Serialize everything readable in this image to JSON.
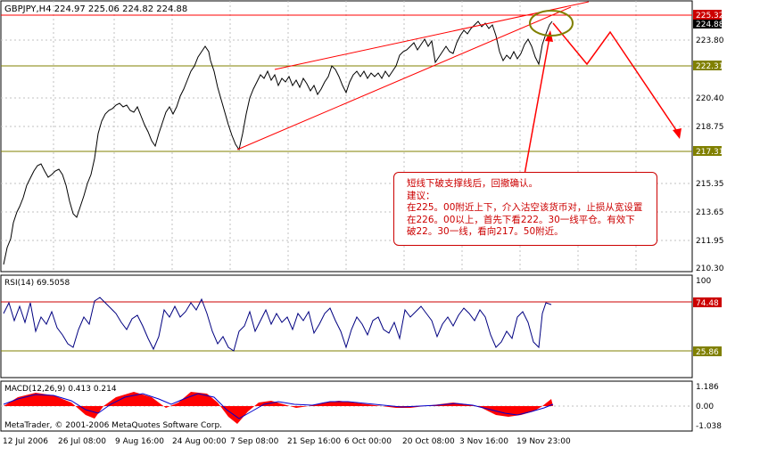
{
  "symbol_header": "GBPJPY,H4  224.97 225.06 224.82 224.88",
  "main_chart": {
    "price_ticks": [
      "223.80",
      "222.31",
      "220.40",
      "218.75",
      "217.31",
      "215.35",
      "213.65",
      "211.95",
      "210.30"
    ],
    "level_labels": {
      "resistance": "225.32",
      "current": "224.88",
      "support_upper": "222.31",
      "support_lower": "217.31"
    },
    "colors": {
      "price_line": "#000000",
      "channel": "#ff0000",
      "level": "#808000",
      "label_red_bg": "#cc0000",
      "label_olive_bg": "#808000",
      "grid": "#c0c0c0"
    }
  },
  "annotation": {
    "line1": "短线下破支撑线后，回撤确认。",
    "line2": "建议：",
    "line3": "在225。00附近上下，介入沽空该货币对，止损从宽设置",
    "line4": "在226。00以上，首先下看222。30一线平仓。有效下",
    "line5": "破22。30一线，看向217。50附近。"
  },
  "rsi_panel": {
    "title": "RSI(14) 69.5058",
    "upper_level": "74.48",
    "lower_level": "25.86",
    "top_tick": "100"
  },
  "macd_panel": {
    "title": "MACD(12,26,9) 0.413 0.214",
    "ticks": [
      "1.186",
      "0.00",
      "-1.038"
    ]
  },
  "time_axis": [
    "12 Jul 2006",
    "26 Jul 08:00",
    "9 Aug 16:00",
    "24 Aug 00:00",
    "7 Sep 08:00",
    "21 Sep 16:00",
    "6 Oct 00:00",
    "20 Oct 08:00",
    "3 Nov 16:00",
    "19 Nov 23:00"
  ],
  "copyright": "MetaTrader, © 2001-2006 MetaQuotes Software Corp."
}
